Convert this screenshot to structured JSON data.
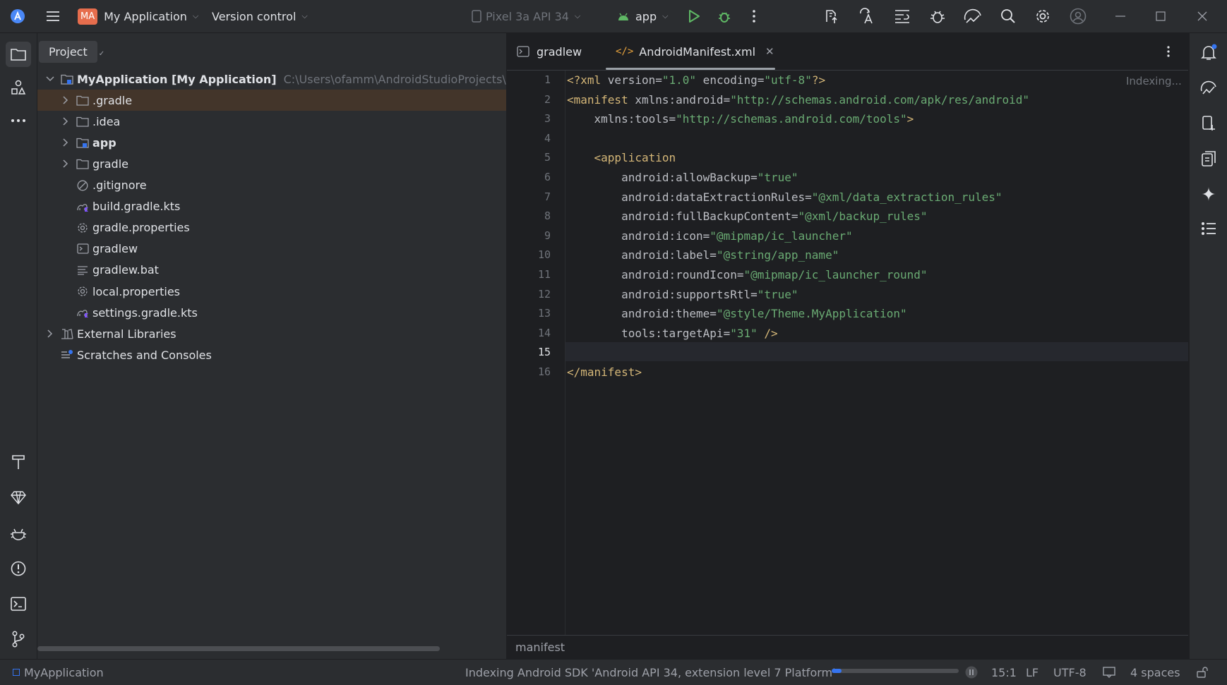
{
  "titlebar": {
    "project_badge": "MA",
    "project_name": "My Application",
    "version_control": "Version control",
    "device": "Pixel 3a API 34",
    "run_config": "app"
  },
  "project_panel": {
    "tab_label": "Project",
    "tree": [
      {
        "label": "MyApplication [My Application]",
        "path": "C:\\Users\\ofamm\\AndroidStudioProjects\\My",
        "icon": "module-folder-icon",
        "expander": "expanded"
      },
      {
        "label": ".gradle",
        "icon": "folder-icon",
        "expander": "collapsed"
      },
      {
        "label": ".idea",
        "icon": "folder-icon",
        "expander": "collapsed"
      },
      {
        "label": "app",
        "icon": "module-folder-icon",
        "expander": "collapsed"
      },
      {
        "label": "gradle",
        "icon": "folder-icon",
        "expander": "collapsed"
      },
      {
        "label": ".gitignore",
        "icon": "ignore-file-icon",
        "expander": "none"
      },
      {
        "label": "build.gradle.kts",
        "icon": "gradle-kotlin-file-icon",
        "expander": "none"
      },
      {
        "label": "gradle.properties",
        "icon": "settings-file-icon",
        "expander": "none"
      },
      {
        "label": "gradlew",
        "icon": "terminal-file-icon",
        "expander": "none"
      },
      {
        "label": "gradlew.bat",
        "icon": "text-file-icon",
        "expander": "none"
      },
      {
        "label": "local.properties",
        "icon": "settings-file-icon",
        "expander": "none"
      },
      {
        "label": "settings.gradle.kts",
        "icon": "gradle-kotlin-file-icon",
        "expander": "none"
      },
      {
        "label": "External Libraries",
        "icon": "library-icon",
        "expander": "collapsed"
      },
      {
        "label": "Scratches and Consoles",
        "icon": "scratches-icon",
        "expander": "none"
      }
    ]
  },
  "editor": {
    "tabs": [
      {
        "label": "gradlew",
        "active": false
      },
      {
        "label": "AndroidManifest.xml",
        "active": true
      }
    ],
    "indexing_label": "Indexing...",
    "current_line": 15,
    "lines": [
      [
        {
          "t": "<?xml ",
          "c": "tag"
        },
        {
          "t": "version",
          "c": "attr"
        },
        {
          "t": "=",
          "c": "attr"
        },
        {
          "t": "\"1.0\"",
          "c": "str"
        },
        {
          "t": " encoding",
          "c": "attr"
        },
        {
          "t": "=",
          "c": "attr"
        },
        {
          "t": "\"utf-8\"",
          "c": "str"
        },
        {
          "t": "?>",
          "c": "tag"
        }
      ],
      [
        {
          "t": "<manifest ",
          "c": "tag"
        },
        {
          "t": "xmlns:android",
          "c": "attr"
        },
        {
          "t": "=",
          "c": "attr"
        },
        {
          "t": "\"http://schemas.android.com/apk/res/android\"",
          "c": "str"
        }
      ],
      [
        {
          "t": "    xmlns:tools",
          "c": "attr"
        },
        {
          "t": "=",
          "c": "attr"
        },
        {
          "t": "\"http://schemas.android.com/tools\"",
          "c": "str"
        },
        {
          "t": ">",
          "c": "tag"
        }
      ],
      [],
      [
        {
          "t": "    <application",
          "c": "tag"
        }
      ],
      [
        {
          "t": "        android:allowBackup",
          "c": "attr"
        },
        {
          "t": "=",
          "c": "attr"
        },
        {
          "t": "\"true\"",
          "c": "str"
        }
      ],
      [
        {
          "t": "        android:dataExtractionRules",
          "c": "attr"
        },
        {
          "t": "=",
          "c": "attr"
        },
        {
          "t": "\"@xml/data_extraction_rules\"",
          "c": "str"
        }
      ],
      [
        {
          "t": "        android:fullBackupContent",
          "c": "attr"
        },
        {
          "t": "=",
          "c": "attr"
        },
        {
          "t": "\"@xml/backup_rules\"",
          "c": "str"
        }
      ],
      [
        {
          "t": "        android:icon",
          "c": "attr"
        },
        {
          "t": "=",
          "c": "attr"
        },
        {
          "t": "\"@mipmap/ic_launcher\"",
          "c": "str"
        }
      ],
      [
        {
          "t": "        android:label",
          "c": "attr"
        },
        {
          "t": "=",
          "c": "attr"
        },
        {
          "t": "\"@string/app_name\"",
          "c": "str"
        }
      ],
      [
        {
          "t": "        android:roundIcon",
          "c": "attr"
        },
        {
          "t": "=",
          "c": "attr"
        },
        {
          "t": "\"@mipmap/ic_launcher_round\"",
          "c": "str"
        }
      ],
      [
        {
          "t": "        android:supportsRtl",
          "c": "attr"
        },
        {
          "t": "=",
          "c": "attr"
        },
        {
          "t": "\"true\"",
          "c": "str"
        }
      ],
      [
        {
          "t": "        android:theme",
          "c": "attr"
        },
        {
          "t": "=",
          "c": "attr"
        },
        {
          "t": "\"@style/Theme.MyApplication\"",
          "c": "str"
        }
      ],
      [
        {
          "t": "        tools:targetApi",
          "c": "attr"
        },
        {
          "t": "=",
          "c": "attr"
        },
        {
          "t": "\"31\"",
          "c": "str"
        },
        {
          "t": " />",
          "c": "tag"
        }
      ],
      [],
      [
        {
          "t": "</manifest>",
          "c": "tag"
        }
      ]
    ],
    "breadcrumb": "manifest"
  },
  "statusbar": {
    "project": "MyApplication",
    "indexing_text": "Indexing Android SDK 'Android API 34, extension level 7 Platform'",
    "progress": 0.08,
    "position": "15:1",
    "line_separator": "LF",
    "encoding": "UTF-8",
    "indent": "4 spaces"
  },
  "colors": {
    "accent": "#3574f0",
    "run_green": "#5fb865",
    "badge_orange": "#e66d4d",
    "selection": "#43352a",
    "xml_tag": "#d5b778",
    "xml_string": "#6aab73"
  }
}
